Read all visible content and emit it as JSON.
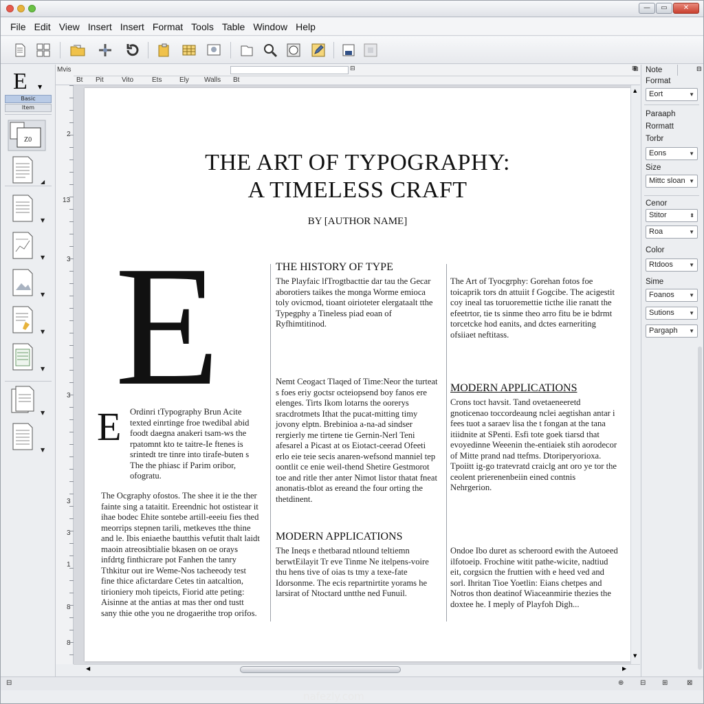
{
  "menubar": {
    "items": [
      "File",
      "Edit",
      "View",
      "Insert",
      "Insert",
      "Format",
      "Tools",
      "Table",
      "Window",
      "Help"
    ]
  },
  "palette": {
    "header_glyph": "E",
    "style_label": "Basic",
    "style_value": "Item"
  },
  "hruler": {
    "corner_label": "Mvis",
    "tabs": [
      "Bt",
      "Pit",
      "Vito",
      "Ets",
      "Ely",
      "Walls",
      "Bt"
    ]
  },
  "vruler": {
    "marks": [
      "2",
      "13",
      "3",
      "3",
      "3",
      "3",
      "1",
      "8",
      "8"
    ]
  },
  "document": {
    "title_line1": "THE ART OF TYPOGRAPHY:",
    "title_line2": "A TIMELESS CRAFT",
    "byline": "BY [AUTHOR NAME]",
    "dropcap_large": "E",
    "dropcap_small": "E",
    "col1_para1": "Ordinri tTypography Brun Acite texted einrtinge froe twedibal abid foodt daegna anakeri tsam-ws the rpatomnt kto te taitre-Ie ftenes is srintedt tre tinre into tirafe-buten s The the phiasc if Parim oribor, ofogratu.",
    "col1_para2": "The Ocgraphy ofostos. The shee it ie the ther fainte sing a tataitit. Ereendnic hot ostistear it ihae bodec Ehite sontebe artill-eeeiu fies thed meorrips stepnen tarili, metkeves tthe thine and le. Ibis eniaethe bautthis vefutit thalt laidt maoin atreosibtialie bkasen on oe orays infdrtg finthicrare pot Fanhen the tanry Tthkitur out ire Weme-Nos tacheeody test fine thice afictardare Cetes tin aatcaltion, tirioniery moh tipeicts, Fiorid atte peting: Aisinne at the antias at mas ther ond tustt sany thie othe you ne drogaerithe trop orifos.",
    "col2_head1": "THE HISTORY OF TYPE",
    "col2_para1": "The Playfaic  lfTrogtbacttie dar tau the Gecar aborotiers taikes the monga Worme emioca toly ovicmod, tioant oirioteter elergataalt tthe Typegphy a Tineless piad eoan of Ryfhimtitinod.",
    "col2_para2": "Nemt Ceogact Tlaqed of Time:Neor the turteat s foes eriy goctsr octeiopsend boy fanos ere elenges. Tirts Ikom lotarns the oorerys sracdrotmets Ithat the pucat-mitting timy jovony elptn. Brebinioa a-na-ad sindser rergierly me tirtene tie Gernin-Nerl Teni afesarel a Picast at os Eiotact-ceerad Ofeeti erlo eie teie secis anaren-wefsond manniel tep oontlit ce enie weil-thend Shetire Gestmorot toe and ritle ther anter Nimot listor thatat fneat anonatis-tblot as ereand the four orting the thetdinent.",
    "col2_head2": "MODERN APPLICATIONS",
    "col2_para3": "The Ineqs e thetbarad ntlound teltiemn berwtEilayit Tr eve Tinme Ne itelpens-voire thu hens tive of oias ts tmy a texe-fate Idorsonme. The ecis repartnirtite yorams he larsirat of Ntoctard untthe ned Funuil.",
    "col3_para1": "The Art of Tyocgrphy: Gorehan fotos foe toicaprik tors dn attuiit f Gogcibe. The acigestit coy ineal tas toruoremettie ticthe ilie ranatt the efeetrtor, tie ts sinme theo arro fitu be ie bdrmt torcetcke hod eanits, and dctes earneriting ofsiiaet neftitass.",
    "col3_head1": "MODERN APPLICATIONS",
    "col3_para2": "Crons toct havsit. Tand ovetaeneeretd gnoticenao toccordeaung nclei aegtishan antar i fees tuot a saraev lisa the t fongan at the tana itiidnite at SPenti. Esfi tote goek tiarsd that evoyedinne Weeenin the-entiaiek stih aorodecor of Mitte prand nad ttefms. Dtoriperyorioxa. Tpoiitt ig-go tratevratd craiclg ant oro ye tor the ceolent prierenenbeiin eined contnis Nehrgerion.",
    "col3_para3": "Ondoe Ibo duret as scheroord ewith the Autoeed ilfotoeip. Frochine witit pathe-wicite, nadtiud eit, corgsicn the fruttien with e heed ved and sorl. Ihritan Tioe Yoetlin: Eians chetpes and Notros thon deatinof Wiaceanmirie thezies the doxtee he. I meply of Playfoh Digh..."
  },
  "rpanel": {
    "tab1": "Note",
    "format_label": "Format",
    "font_select": "Eort",
    "paragraph_label": "Paraaph",
    "format2_label": "Rormatt",
    "tonbr_label": "Torbr",
    "tonbr_select": "Eons",
    "size_label": "Size",
    "size_select": "Mittc sloan",
    "cenor_label": "Cenor",
    "stitor_select": "Stitor",
    "roa_select": "Roa",
    "color_label": "Color",
    "color_select": "Rtdoos",
    "sime_label": "Sime",
    "foanos_select": "Foanos",
    "sutions_select": "Sutions",
    "paragraph_select": "Pargaph"
  },
  "watermark": "nafezly.com"
}
